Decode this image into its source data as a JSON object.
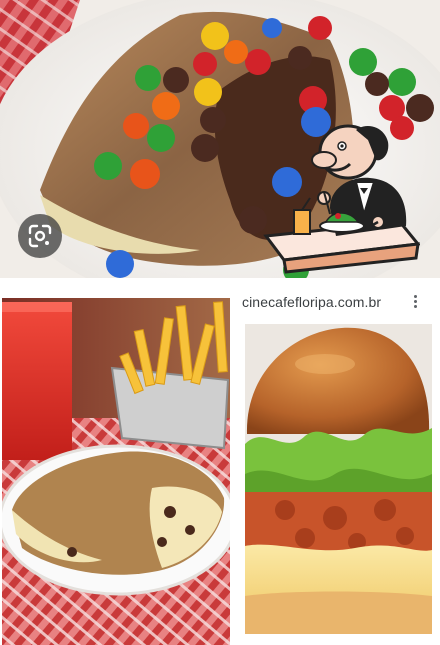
{
  "results": {
    "source_label": "cinecafefloripa.com.br"
  },
  "icons": {
    "lens": "google-lens-icon",
    "more": "more-vert-icon",
    "restaurant": "dining-waiter-icon"
  },
  "colors": {
    "text": "#3c4043",
    "icon": "#5f6368"
  }
}
